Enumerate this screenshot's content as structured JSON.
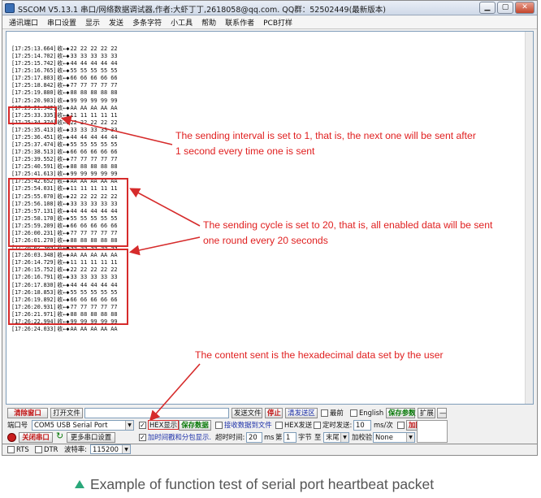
{
  "window": {
    "title": "SSCOM V5.13.1 串口/网络数据调试器,作者:大虾丁丁,2618058@qq.com. QQ群：52502449(最新版本)",
    "min_glyph": "▁",
    "max_glyph": "▢",
    "close_glyph": "✕"
  },
  "menu": [
    "通讯端口",
    "串口设置",
    "显示",
    "发送",
    "多条字符",
    "小工具",
    "帮助",
    "联系作者",
    "PCB打样"
  ],
  "log": {
    "arrow": "收←◆",
    "lines": [
      {
        "ts": "[17:25:13.664]",
        "data": "22 22 22 22 22"
      },
      {
        "ts": "[17:25:14.702]",
        "data": "33 33 33 33 33"
      },
      {
        "ts": "[17:25:15.742]",
        "data": "44 44 44 44 44"
      },
      {
        "ts": "[17:25:16.765]",
        "data": "55 55 55 55 55"
      },
      {
        "ts": "[17:25:17.803]",
        "data": "66 66 66 66 66"
      },
      {
        "ts": "[17:25:18.842]",
        "data": "77 77 77 77 77"
      },
      {
        "ts": "[17:25:19.880]",
        "data": "88 88 88 88 88"
      },
      {
        "ts": "[17:25:20.903]",
        "data": "99 99 99 99 99"
      },
      {
        "ts": "[17:25:21.942]",
        "data": "AA AA AA AA AA"
      },
      {
        "ts": "[17:25:33.335]",
        "data": "11 11 11 11 11"
      },
      {
        "ts": "[17:25:34.374]",
        "data": "22 22 22 22 22"
      },
      {
        "ts": "[17:25:35.413]",
        "data": "33 33 33 33 33"
      },
      {
        "ts": "[17:25:36.451]",
        "data": "44 44 44 44 44"
      },
      {
        "ts": "[17:25:37.474]",
        "data": "55 55 55 55 55"
      },
      {
        "ts": "[17:25:38.513]",
        "data": "66 66 66 66 66"
      },
      {
        "ts": "[17:25:39.552]",
        "data": "77 77 77 77 77"
      },
      {
        "ts": "[17:25:40.591]",
        "data": "88 88 88 88 88"
      },
      {
        "ts": "[17:25:41.613]",
        "data": "99 99 99 99 99"
      },
      {
        "ts": "[17:25:42.652]",
        "data": "AA AA AA AA AA"
      },
      {
        "ts": "[17:25:54.031]",
        "data": "11 11 11 11 11"
      },
      {
        "ts": "[17:25:55.070]",
        "data": "22 22 22 22 22"
      },
      {
        "ts": "[17:25:56.108]",
        "data": "33 33 33 33 33"
      },
      {
        "ts": "[17:25:57.131]",
        "data": "44 44 44 44 44"
      },
      {
        "ts": "[17:25:58.170]",
        "data": "55 55 55 55 55"
      },
      {
        "ts": "[17:25:59.209]",
        "data": "66 66 66 66 66"
      },
      {
        "ts": "[17:26:00.231]",
        "data": "77 77 77 77 77"
      },
      {
        "ts": "[17:26:01.270]",
        "data": "88 88 88 88 88"
      },
      {
        "ts": "[17:26:02.309]",
        "data": "99 99 99 99 99"
      },
      {
        "ts": "[17:26:03.348]",
        "data": "AA AA AA AA AA"
      },
      {
        "ts": "[17:26:14.729]",
        "data": "11 11 11 11 11"
      },
      {
        "ts": "[17:26:15.752]",
        "data": "22 22 22 22 22"
      },
      {
        "ts": "[17:26:16.791]",
        "data": "33 33 33 33 33"
      },
      {
        "ts": "[17:26:17.830]",
        "data": "44 44 44 44 44"
      },
      {
        "ts": "[17:26:18.853]",
        "data": "55 55 55 55 55"
      },
      {
        "ts": "[17:26:19.892]",
        "data": "66 66 66 66 66"
      },
      {
        "ts": "[17:26:20.931]",
        "data": "77 77 77 77 77"
      },
      {
        "ts": "[17:26:21.971]",
        "data": "88 88 88 88 88"
      },
      {
        "ts": "[17:26:22.994]",
        "data": "99 99 99 99 99"
      },
      {
        "ts": "[17:26:24.033]",
        "data": "AA AA AA AA AA"
      }
    ]
  },
  "annotations": {
    "interval_line1": "The sending interval is set to 1, that is, the next one will be sent after",
    "interval_line2": "1 second every time one is sent",
    "cycle_line1": "The sending cycle is set to 20, that is, all enabled data will be sent",
    "cycle_line2": "one round every 20 seconds",
    "content": "The content sent is the hexadecimal data set by the user",
    "color": "#e02020"
  },
  "controls": {
    "clear_window": "清除窗口",
    "open_file": "打开文件",
    "send_file": "发送文件",
    "stop": "停止",
    "clear_send": "清发送区",
    "last_label": "最前",
    "english_label": "English",
    "save_params": "保存参数",
    "expand": "扩展",
    "collapse": "—",
    "port_label": "端口号",
    "port_value": "COM5 USB Serial Port",
    "hex_display": "HEX显示",
    "save_data": "保存数据",
    "receive_to_file": "接收数据到文件",
    "hex_send": "HEX发送",
    "timed_send": "定时发送:",
    "timed_value": "10",
    "timed_unit": "ms/次",
    "add_crlf": "加回车换行",
    "close_port": "关闭串口",
    "more_settings": "更多串口设置",
    "add_timestamp": "加时间戳和分包显示.",
    "timeout_label": "超时时间:",
    "timeout_value": "20",
    "ms_label": "ms",
    "nth_label": "第",
    "nth_value": "1",
    "byte_label": "字节",
    "to_label": "至",
    "end_value": "末尾",
    "checksum_label": "加校验",
    "checksum_value": "None",
    "rts": "RTS",
    "dtr": "DTR",
    "baud_label": "波特率:",
    "baud_value": "115200"
  },
  "caption": "Example of function test of serial port heartbeat packet"
}
